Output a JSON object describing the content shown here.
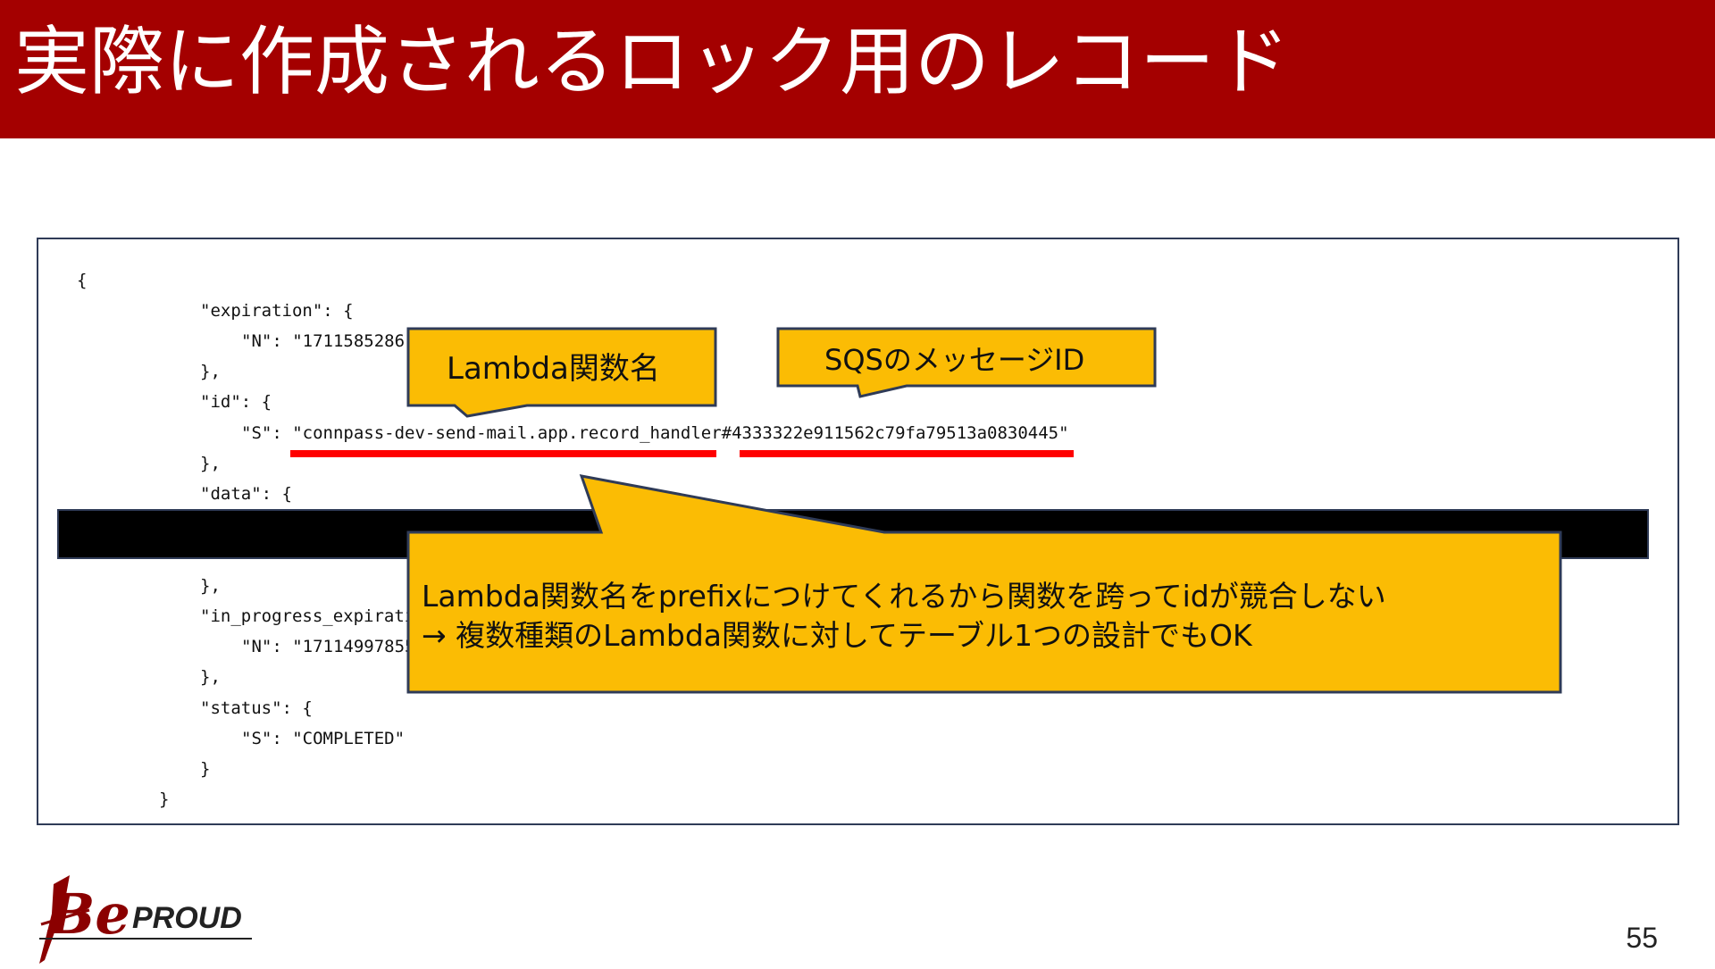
{
  "slide": {
    "title": "実際に作成されるロック用のレコード",
    "page_number": "55"
  },
  "code": {
    "lines": [
      "{",
      "\"expiration\": {",
      "\"N\": \"1711585286\"",
      "},",
      "\"id\": {",
      "\"S\": \"connpass-dev-send-mail.app.record_handler#4333322e911562c79fa79513a0830445\"",
      "},",
      "\"data\": {",
      "},",
      "\"in_progress_expirati",
      "\"N\": \"17114997855",
      "},",
      "\"status\": {",
      "\"S\": \"COMPLETED\"",
      "}",
      "}"
    ]
  },
  "callouts": {
    "lambda_name": "Lambda関数名",
    "sqs_message_id": "SQSのメッセージID",
    "note_line1": "Lambda関数名をprefixにつけてくれるから関数を跨ってidが競合しない",
    "note_line2": "→ 複数種類のLambda関数に対してテーブル1つの設計でもOK"
  },
  "logo": {
    "text_be": "Be",
    "text_proud": "PROUD"
  },
  "colors": {
    "header": "#a40000",
    "callout": "#fbbc04",
    "underline": "#ff0000",
    "border": "#2f3b57"
  }
}
